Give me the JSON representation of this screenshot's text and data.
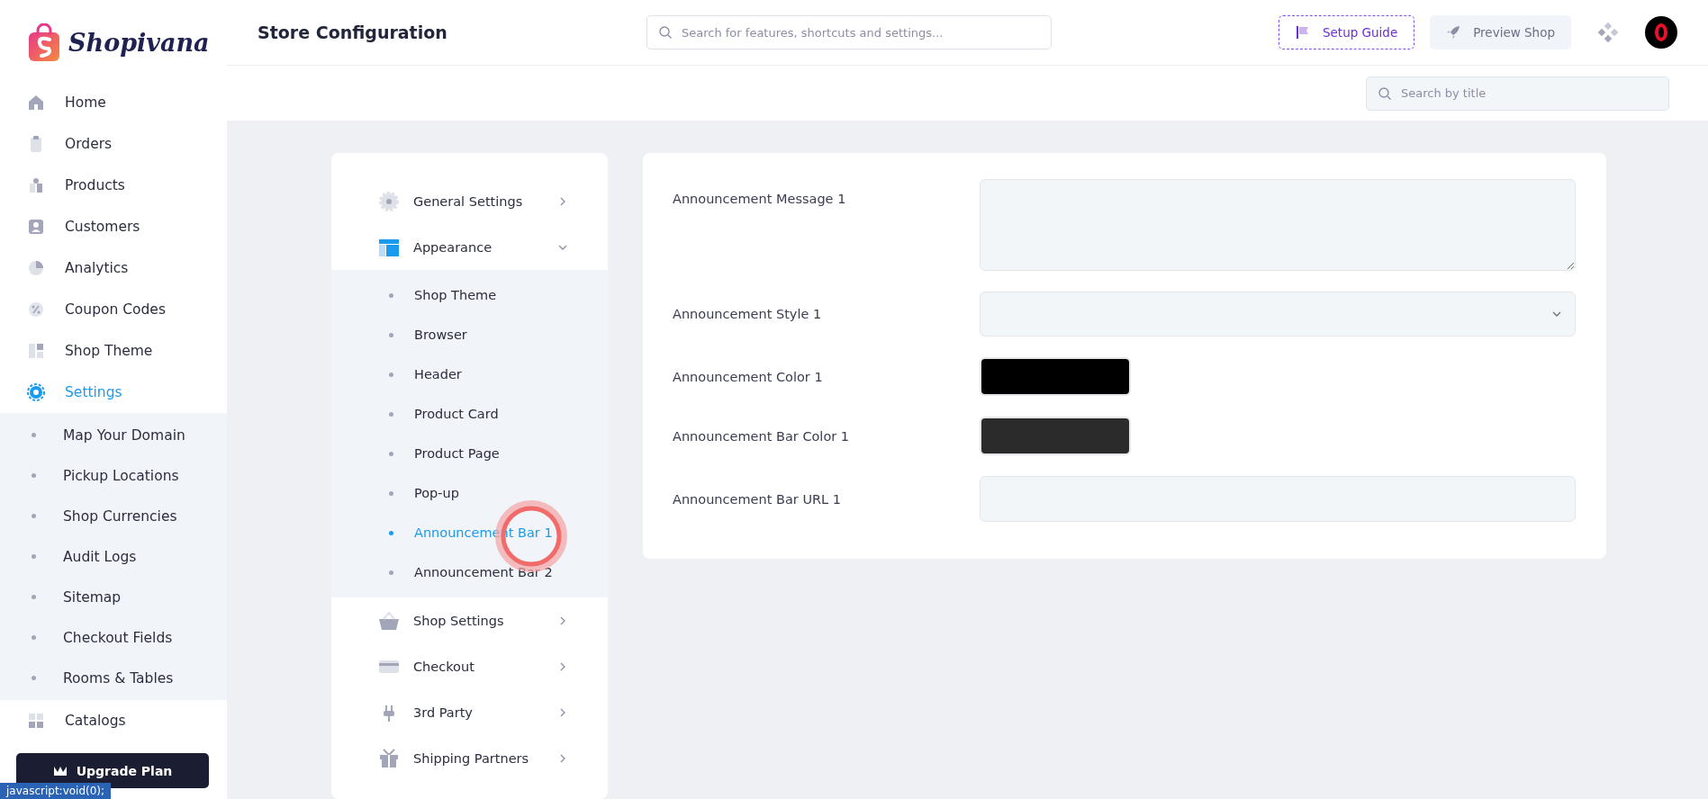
{
  "brand": {
    "name": "Shopivana"
  },
  "header": {
    "title": "Store Configuration",
    "search": {
      "placeholder": "Search for features, shortcuts and settings..."
    },
    "setup_button": "Setup Guide",
    "preview_button": "Preview Shop"
  },
  "subheader": {
    "search": {
      "placeholder": "Search by title"
    }
  },
  "sidebar": {
    "items": [
      {
        "label": "Home",
        "selected": false
      },
      {
        "label": "Orders",
        "selected": false
      },
      {
        "label": "Products",
        "selected": false
      },
      {
        "label": "Customers",
        "selected": false
      },
      {
        "label": "Analytics",
        "selected": false
      },
      {
        "label": "Coupon Codes",
        "selected": false
      },
      {
        "label": "Shop Theme",
        "selected": false
      },
      {
        "label": "Settings",
        "selected": true,
        "expanded": true,
        "children": [
          {
            "label": "Map Your Domain"
          },
          {
            "label": "Pickup Locations"
          },
          {
            "label": "Shop Currencies"
          },
          {
            "label": "Audit Logs"
          },
          {
            "label": "Sitemap"
          },
          {
            "label": "Checkout Fields"
          },
          {
            "label": "Rooms & Tables"
          }
        ]
      },
      {
        "label": "Catalogs",
        "selected": false
      }
    ],
    "upgrade_button": "Upgrade Plan"
  },
  "settings_menu": {
    "items": [
      {
        "label": "General Settings",
        "expanded": false
      },
      {
        "label": "Appearance",
        "expanded": true,
        "children": [
          {
            "label": "Shop Theme",
            "selected": false
          },
          {
            "label": "Browser",
            "selected": false
          },
          {
            "label": "Header",
            "selected": false
          },
          {
            "label": "Product Card",
            "selected": false
          },
          {
            "label": "Product Page",
            "selected": false
          },
          {
            "label": "Pop-up",
            "selected": false
          },
          {
            "label": "Announcement Bar 1",
            "selected": true
          },
          {
            "label": "Announcement Bar 2",
            "selected": false
          }
        ]
      },
      {
        "label": "Shop Settings",
        "expanded": false
      },
      {
        "label": "Checkout",
        "expanded": false
      },
      {
        "label": "3rd Party",
        "expanded": false
      },
      {
        "label": "Shipping Partners",
        "expanded": false
      }
    ]
  },
  "form": {
    "fields": [
      {
        "label": "Announcement Message 1",
        "kind": "textarea"
      },
      {
        "label": "Announcement Style 1",
        "kind": "select"
      },
      {
        "label": "Announcement Color 1",
        "kind": "color",
        "color": "#000000"
      },
      {
        "label": "Announcement Bar Color 1",
        "kind": "color",
        "color": "#2b2b2b"
      },
      {
        "label": "Announcement Bar URL 1",
        "kind": "text"
      }
    ]
  },
  "status_link": "javascript:void(0);"
}
